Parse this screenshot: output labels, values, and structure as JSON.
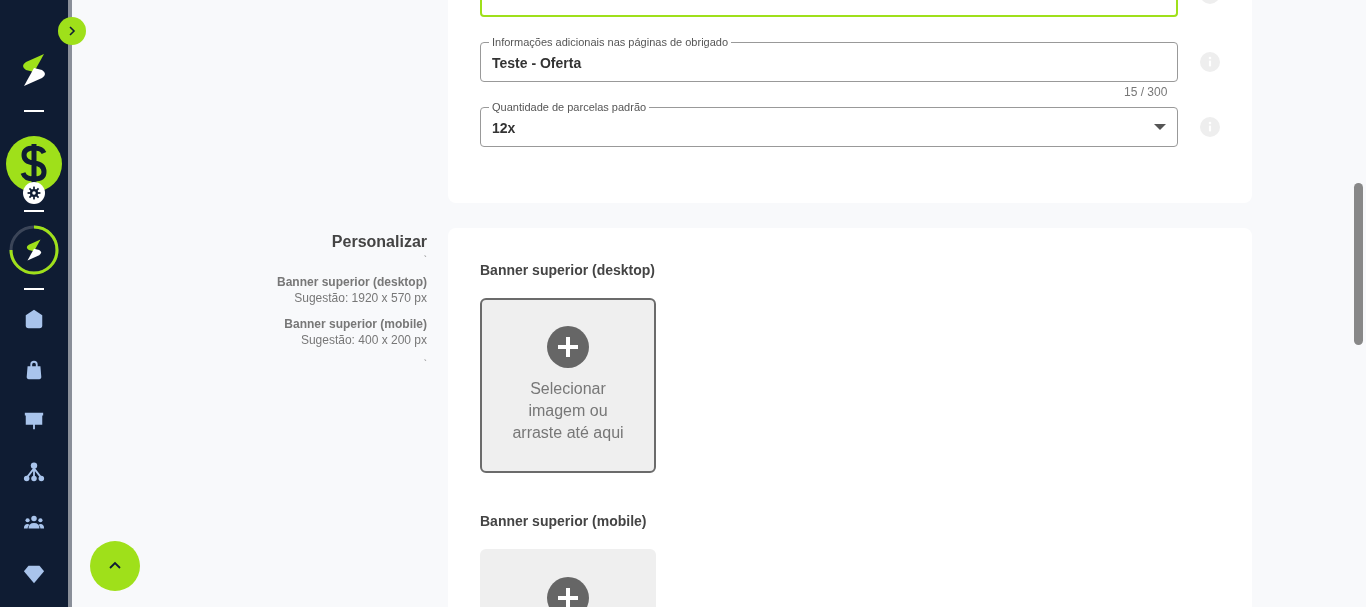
{
  "top_field": {
    "focused": true
  },
  "fields": [
    {
      "kind": "text",
      "label": "Informações adicionais nas páginas de obrigado",
      "value": "Teste - Oferta",
      "counter": "15 / 300"
    },
    {
      "kind": "select",
      "label": "Quantidade de parcelas padrão",
      "value": "12x"
    }
  ],
  "section": {
    "title": "Personalizar",
    "marks": [
      "`",
      "`"
    ],
    "hints": [
      {
        "title": "Banner superior (desktop)",
        "text": "Sugestão: 1920 x 570 px"
      },
      {
        "title": "Banner superior (mobile)",
        "text": "Sugestão: 400 x 200 px"
      }
    ]
  },
  "uploads": [
    {
      "label": "Banner superior (desktop)",
      "text": "Selecionar imagem ou arraste até aqui",
      "hovered": true
    },
    {
      "label": "Banner superior (mobile)",
      "hovered": false
    }
  ]
}
